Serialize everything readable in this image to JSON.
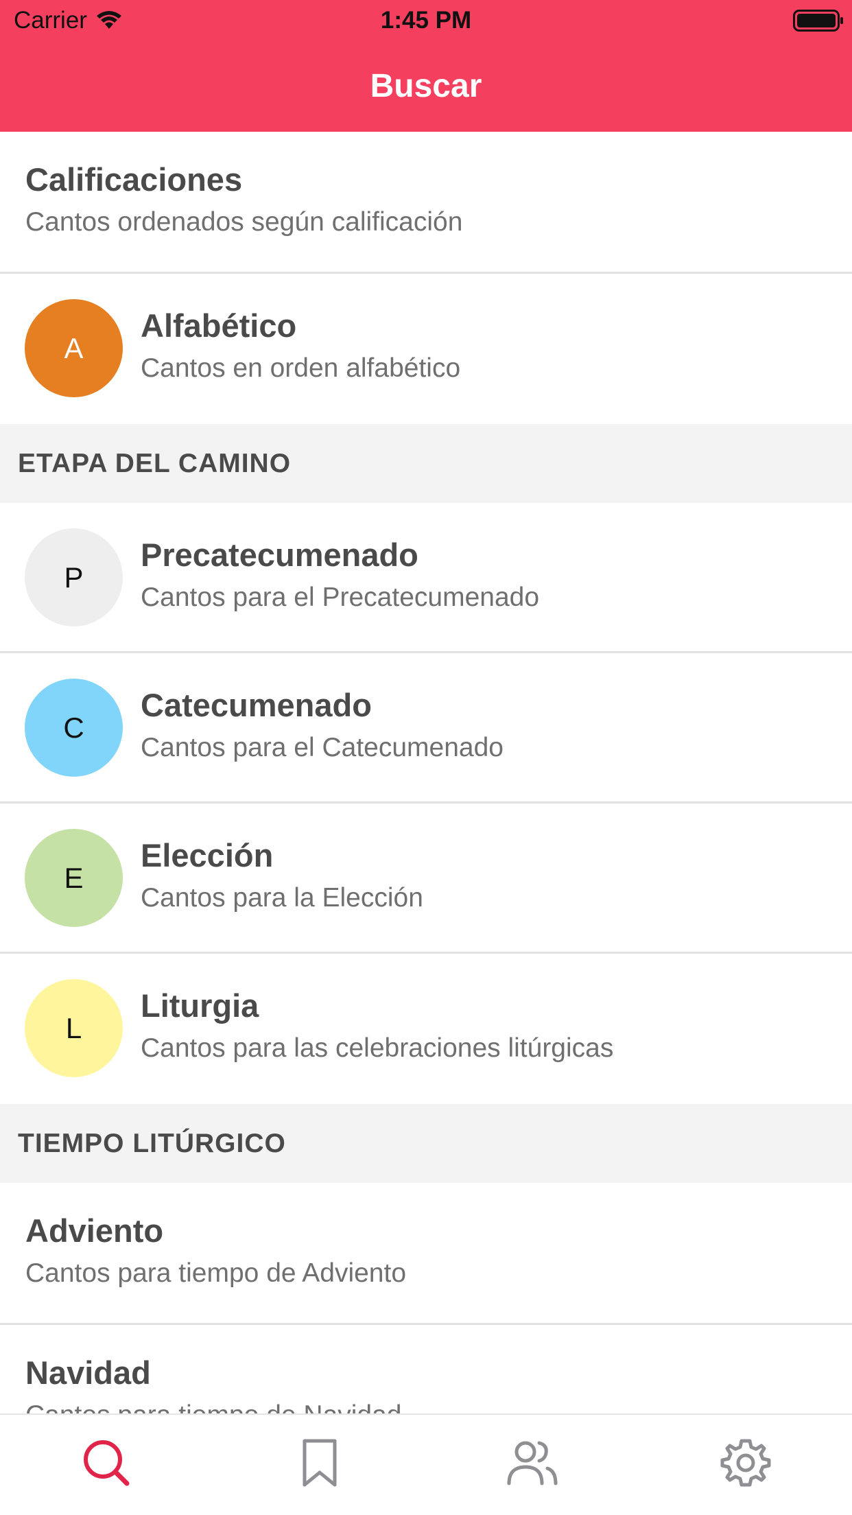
{
  "status_bar": {
    "carrier": "Carrier",
    "time": "1:45 PM"
  },
  "nav": {
    "title": "Buscar"
  },
  "colors": {
    "header": "#f43f5e",
    "tab_active": "#e0244a",
    "tab_inactive": "#8e8e93"
  },
  "rows_top": [
    {
      "title": "Calificaciones",
      "subtitle": "Cantos ordenados según calificación"
    },
    {
      "avatar": "A",
      "avatar_color": "#e67e22",
      "title": "Alfabético",
      "subtitle": "Cantos en orden alfabético"
    }
  ],
  "section_etapa": {
    "header": "ETAPA DEL CAMINO",
    "items": [
      {
        "avatar": "P",
        "avatar_color": "#eeeeee",
        "title": "Precatecumenado",
        "subtitle": "Cantos para el Precatecumenado"
      },
      {
        "avatar": "C",
        "avatar_color": "#81d4fa",
        "title": "Catecumenado",
        "subtitle": "Cantos para el Catecumenado"
      },
      {
        "avatar": "E",
        "avatar_color": "#c5e1a5",
        "title": "Elección",
        "subtitle": "Cantos para la Elección"
      },
      {
        "avatar": "L",
        "avatar_color": "#fff59d",
        "title": "Liturgia",
        "subtitle": "Cantos para las celebraciones litúrgicas"
      }
    ]
  },
  "section_tiempo": {
    "header": "TIEMPO LITÚRGICO",
    "items": [
      {
        "title": "Adviento",
        "subtitle": "Cantos para tiempo de Adviento"
      },
      {
        "title": "Navidad",
        "subtitle": "Cantos para tiempo de Navidad"
      }
    ]
  },
  "tabs": [
    {
      "icon": "search-icon",
      "active": true
    },
    {
      "icon": "bookmark-icon",
      "active": false
    },
    {
      "icon": "users-icon",
      "active": false
    },
    {
      "icon": "gear-icon",
      "active": false
    }
  ]
}
